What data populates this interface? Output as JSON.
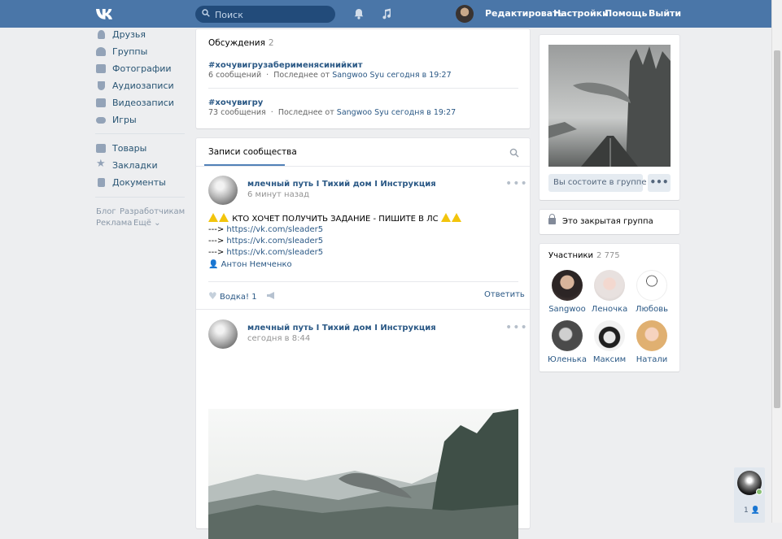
{
  "header": {
    "logo": "VK",
    "search_placeholder": "Поиск",
    "links": [
      "Редактировать",
      "Настройки",
      "Помощь",
      "Выйти"
    ]
  },
  "sidebar": {
    "items": [
      {
        "label": "Друзья",
        "icon": "friends-icon"
      },
      {
        "label": "Группы",
        "icon": "groups-icon"
      },
      {
        "label": "Фотографии",
        "icon": "camera-icon"
      },
      {
        "label": "Аудиозаписи",
        "icon": "music-icon"
      },
      {
        "label": "Видеозаписи",
        "icon": "video-icon"
      },
      {
        "label": "Игры",
        "icon": "gamepad-icon"
      },
      {
        "label": "Товары",
        "icon": "bag-icon"
      },
      {
        "label": "Закладки",
        "icon": "star-icon"
      },
      {
        "label": "Документы",
        "icon": "document-icon"
      }
    ],
    "footer_links": [
      "Блог",
      "Разработчикам",
      "Реклама",
      "Ещё"
    ]
  },
  "discussions": {
    "title": "Обсуждения",
    "count": "2",
    "topics": [
      {
        "name": "#хочувигрузаберименясинийкит",
        "messages": "6 сообщений",
        "last_prefix": "Последнее от",
        "author": "Sangwoo Syu",
        "time": "сегодня в 19:27"
      },
      {
        "name": "#хочувигру",
        "messages": "73 сообщения",
        "last_prefix": "Последнее от",
        "author": "Sangwoo Syu",
        "time": "сегодня в 19:27"
      }
    ]
  },
  "wall": {
    "tab_label": "Записи сообщества",
    "posts": [
      {
        "author": "млечный путь I Тихий дом I Инструкция",
        "time": "6 минут назад",
        "line1": "КТО ХОЧЕТ ПОЛУЧИТЬ ЗАДАНИЕ - ПИШИТЕ В ЛС",
        "arrow": "--->",
        "link": "https://vk.com/sleader5",
        "signature": "Антон Немченко",
        "like_label": "Водка!",
        "like_count": "1",
        "reply": "Ответить"
      },
      {
        "author": "млечный путь I Тихий дом I Инструкция",
        "time": "сегодня в 8:44"
      }
    ]
  },
  "group": {
    "state_button": "Вы состоите в группе",
    "more_button": "•••",
    "closed_text": "Это закрытая группа"
  },
  "members": {
    "title": "Участники",
    "count": "2 775",
    "list": [
      "Sangwoo",
      "Леночка",
      "Любовь",
      "Юленька",
      "Максим",
      "Натали"
    ]
  },
  "chat": {
    "count": "1"
  }
}
